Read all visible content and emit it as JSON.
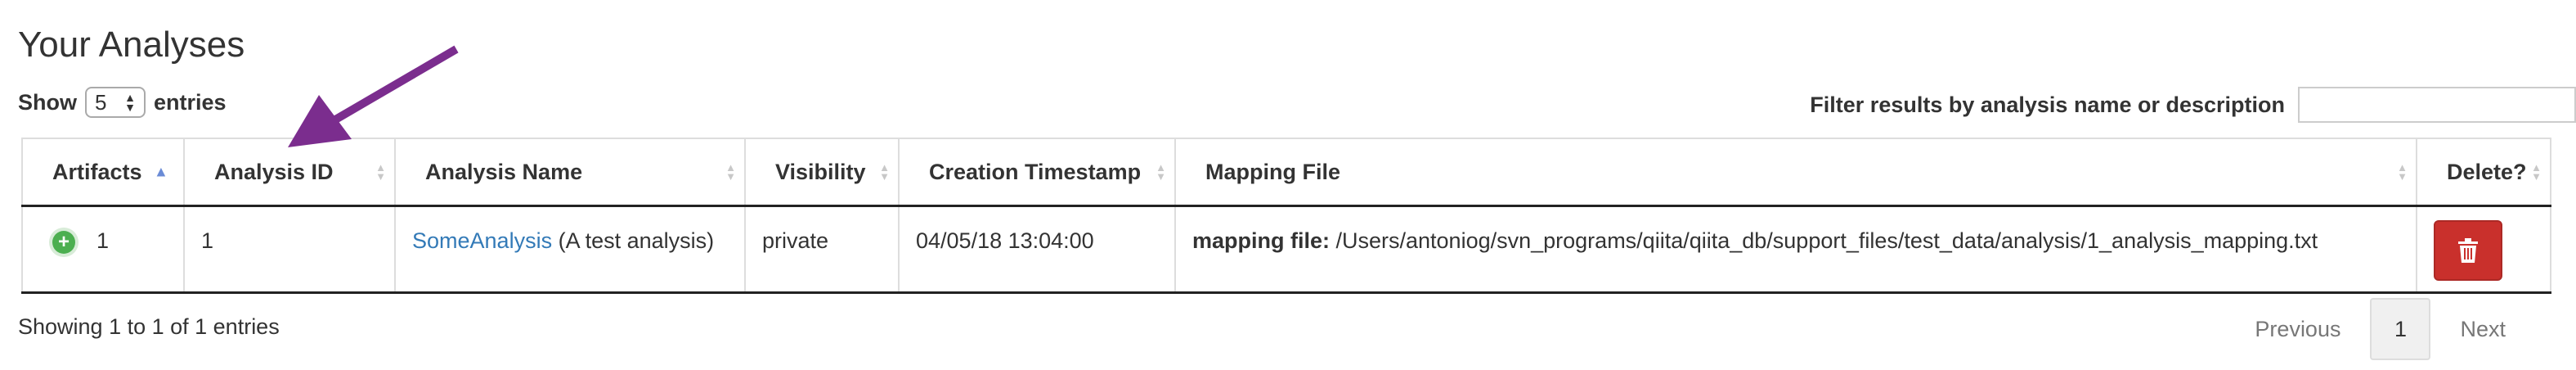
{
  "page": {
    "title": "Your Analyses"
  },
  "length_menu": {
    "show_label": "Show",
    "value": "5",
    "entries_label": "entries"
  },
  "filter": {
    "label": "Filter results by analysis name or description",
    "placeholder": ""
  },
  "table": {
    "headers": [
      "Artifacts",
      "Analysis ID",
      "Analysis Name",
      "Visibility",
      "Creation Timestamp",
      "Mapping File",
      "Delete?"
    ],
    "rows": [
      {
        "artifacts": "1",
        "analysis_id": "1",
        "analysis_name_link": "SomeAnalysis",
        "analysis_description": " (A test analysis)",
        "visibility": "private",
        "created": "04/05/18 13:04:00",
        "mapping_label": "mapping file:",
        "mapping_path": " /Users/antoniog/svn_programs/qiita/qiita_db/support_files/test_data/analysis/1_analysis_mapping.txt"
      }
    ]
  },
  "footer": {
    "info": "Showing 1 to 1 of 1 entries",
    "previous": "Previous",
    "current_page": "1",
    "next": "Next"
  },
  "colors": {
    "link": "#337ab7",
    "delete": "#c9302c",
    "arrow": "#7b2d8e",
    "plus": "#4caf50"
  },
  "icons": {
    "sort_asc": "sort-asc-icon",
    "sort_both": "sort-both-icon",
    "expand": "plus-circle-icon",
    "delete": "trash-icon",
    "annotation": "arrow-icon"
  }
}
